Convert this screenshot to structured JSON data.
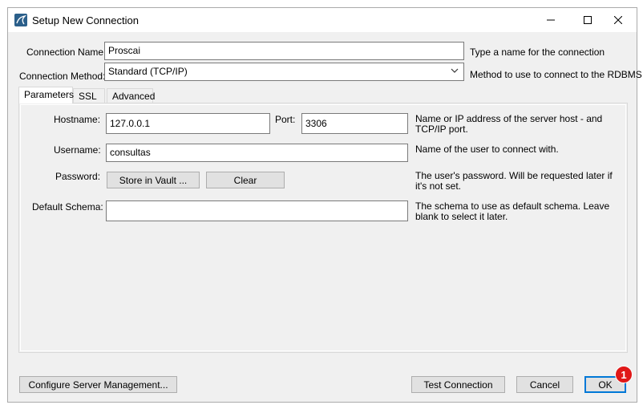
{
  "window": {
    "title": "Setup New Connection",
    "icon": "mysql-workbench-icon",
    "controls": [
      "minimize-icon",
      "maximize-icon",
      "close-icon"
    ]
  },
  "connection": {
    "name_label": "Connection Name:",
    "name_value": "Proscai",
    "name_desc": "Type a name for the connection",
    "method_label": "Connection Method:",
    "method_value": "Standard (TCP/IP)",
    "method_desc": "Method to use to connect to the RDBMS"
  },
  "tabs": [
    {
      "label": "Parameters",
      "active": true
    },
    {
      "label": "SSL",
      "active": false
    },
    {
      "label": "Advanced",
      "active": false
    }
  ],
  "params": {
    "hostname_label": "Hostname:",
    "hostname_value": "127.0.0.1",
    "port_label": "Port:",
    "port_value": "3306",
    "hostname_desc": "Name or IP address of the server host - and TCP/IP port.",
    "username_label": "Username:",
    "username_value": "consultas",
    "username_desc": "Name of the user to connect with.",
    "password_label": "Password:",
    "store_vault_label": "Store in Vault ...",
    "clear_label": "Clear",
    "password_desc": "The user's password. Will be requested later if it's not set.",
    "schema_label": "Default Schema:",
    "schema_value": "",
    "schema_desc": "The schema to use as default schema. Leave blank to select it later."
  },
  "footer": {
    "configure_label": "Configure Server Management...",
    "test_label": "Test Connection",
    "cancel_label": "Cancel",
    "ok_label": "OK",
    "badge_text": "1"
  },
  "colors": {
    "accent": "#0078d7",
    "badge": "#e01818"
  }
}
